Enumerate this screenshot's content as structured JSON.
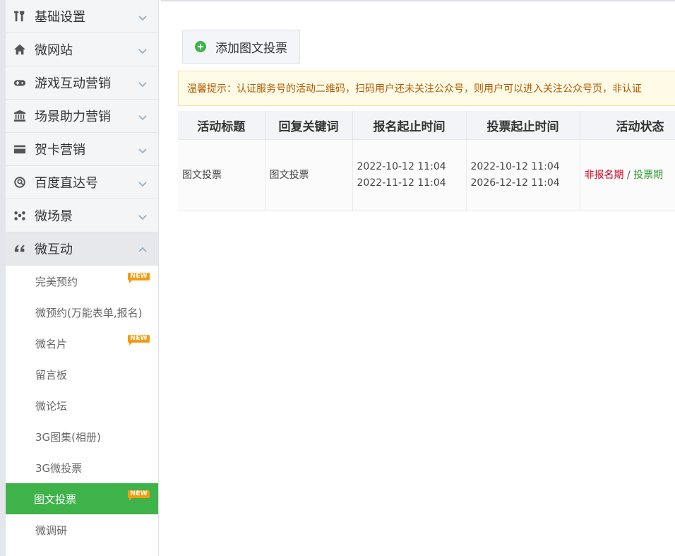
{
  "sidebar": {
    "groups": [
      {
        "label": "基础设置",
        "icon": "tools-icon"
      },
      {
        "label": "微网站",
        "icon": "home-icon"
      },
      {
        "label": "游戏互动营销",
        "icon": "gamepad-icon"
      },
      {
        "label": "场景助力营销",
        "icon": "bank-icon"
      },
      {
        "label": "贺卡营销",
        "icon": "card-icon"
      },
      {
        "label": "百度直达号",
        "icon": "search-icon"
      },
      {
        "label": "微场景",
        "icon": "molecule-icon"
      },
      {
        "label": "微互动",
        "icon": "quote-icon"
      }
    ],
    "sub_items": [
      {
        "label": "完美预约",
        "badge": "NEW"
      },
      {
        "label": "微预约(万能表单,报名)"
      },
      {
        "label": "微名片",
        "badge": "NEW"
      },
      {
        "label": "留言板"
      },
      {
        "label": "微论坛"
      },
      {
        "label": "3G图集(相册)"
      },
      {
        "label": "3G微投票"
      },
      {
        "label": "图文投票",
        "badge": "NEW"
      },
      {
        "label": "微调研"
      }
    ]
  },
  "main": {
    "add_button_label": "添加图文投票",
    "notice": "温馨提示：认证服务号的活动二维码，扫码用户还未关注公众号，则用户可以进入关注公众号页，非认证",
    "table": {
      "headers": [
        "活动标题",
        "回复关键词",
        "报名起止时间",
        "投票起止时间",
        "活动状态"
      ],
      "rows": [
        {
          "title": "图文投票",
          "keyword": "图文投票",
          "signup_start": "2022-10-12 11:04",
          "signup_end": "2022-11-12 11:04",
          "vote_start": "2022-10-12 11:04",
          "vote_end": "2026-12-12 11:04",
          "status_a": "非报名期",
          "status_sep": "/",
          "status_b": "投票期"
        }
      ]
    }
  },
  "colors": {
    "accent_green": "#3eb34a",
    "badge_orange": "#f39c12",
    "status_red": "#d0021b",
    "status_green": "#2e9a2e"
  }
}
